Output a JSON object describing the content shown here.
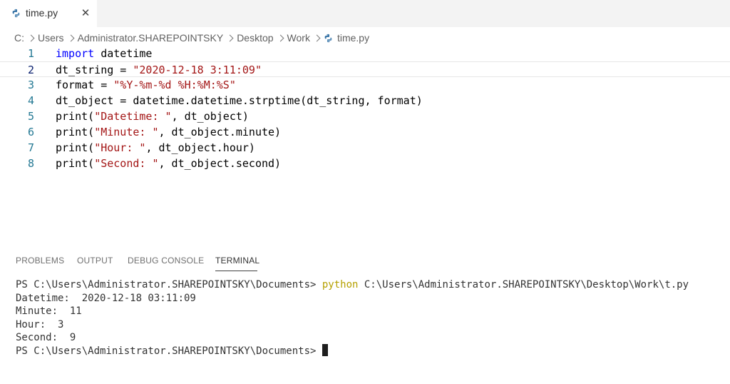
{
  "tab": {
    "filename": "time.py",
    "close_glyph": "✕",
    "icon": "python-icon"
  },
  "breadcrumb": {
    "items": [
      "C:",
      "Users",
      "Administrator.SHAREPOINTSKY",
      "Desktop",
      "Work"
    ],
    "file": "time.py"
  },
  "editor": {
    "line_numbers": [
      "1",
      "2",
      "3",
      "4",
      "5",
      "6",
      "7",
      "8"
    ],
    "current_line": 2,
    "lines": [
      [
        {
          "t": "kw",
          "v": "import"
        },
        {
          "t": "p",
          "v": " datetime"
        }
      ],
      [
        {
          "t": "p",
          "v": "dt_string = "
        },
        {
          "t": "str",
          "v": "\"2020-12-18 3:11:09\""
        }
      ],
      [
        {
          "t": "p",
          "v": "format = "
        },
        {
          "t": "str",
          "v": "\"%Y-%m-%d %H:%M:%S\""
        }
      ],
      [
        {
          "t": "p",
          "v": "dt_object = datetime.datetime.strptime(dt_string, format)"
        }
      ],
      [
        {
          "t": "p",
          "v": "print("
        },
        {
          "t": "str",
          "v": "\"Datetime: \""
        },
        {
          "t": "p",
          "v": ", dt_object)"
        }
      ],
      [
        {
          "t": "p",
          "v": "print("
        },
        {
          "t": "str",
          "v": "\"Minute: \""
        },
        {
          "t": "p",
          "v": ", dt_object.minute)"
        }
      ],
      [
        {
          "t": "p",
          "v": "print("
        },
        {
          "t": "str",
          "v": "\"Hour: \""
        },
        {
          "t": "p",
          "v": ", dt_object.hour)"
        }
      ],
      [
        {
          "t": "p",
          "v": "print("
        },
        {
          "t": "str",
          "v": "\"Second: \""
        },
        {
          "t": "p",
          "v": ", dt_object.second)"
        }
      ]
    ]
  },
  "panel": {
    "tabs": [
      "PROBLEMS",
      "OUTPUT",
      "DEBUG CONSOLE",
      "TERMINAL"
    ],
    "active_tab": "TERMINAL"
  },
  "terminal": {
    "prompt1": "PS C:\\Users\\Administrator.SHAREPOINTSKY\\Documents> ",
    "command": "python",
    "args": " C:\\Users\\Administrator.SHAREPOINTSKY\\Desktop\\Work\\t.py",
    "output": [
      "Datetime:  2020-12-18 03:11:09",
      "Minute:  11",
      "Hour:  3",
      "Second:  9"
    ],
    "prompt2": "PS C:\\Users\\Administrator.SHAREPOINTSKY\\Documents>"
  },
  "colors": {
    "keyword": "#0000ff",
    "string": "#a31515",
    "line_number": "#237893",
    "terminal_command": "#b5a000"
  }
}
